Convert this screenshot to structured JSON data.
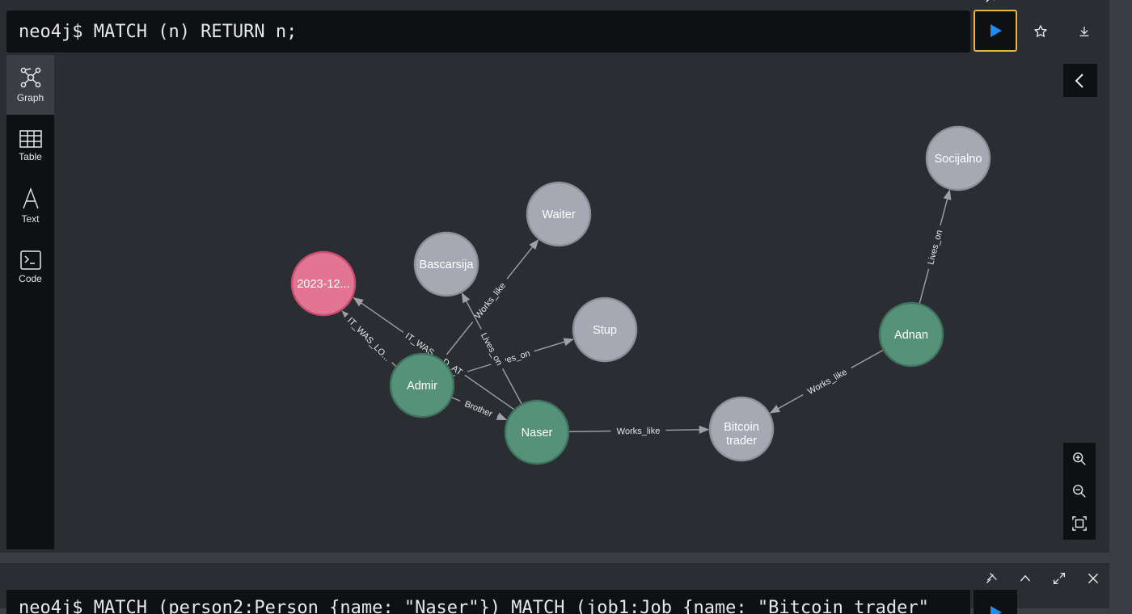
{
  "frame1": {
    "prompt": "neo4j$",
    "query": "MATCH (n) RETURN n;",
    "run_button_color": "#1c8cf0",
    "run_border_color": "#f0b23a"
  },
  "sidebar": {
    "items": [
      {
        "label": "Graph",
        "icon": "graph-icon",
        "active": true
      },
      {
        "label": "Table",
        "icon": "table-icon",
        "active": false
      },
      {
        "label": "Text",
        "icon": "text-icon",
        "active": false
      },
      {
        "label": "Code",
        "icon": "code-icon",
        "active": false
      }
    ]
  },
  "graph": {
    "colors": {
      "person": "#56917a",
      "person_border": "#3f735d",
      "date": "#e27592",
      "date_border": "#c94d70",
      "other": "#a6a9b3",
      "other_border": "#8c8f98",
      "edge": "#9ea1a8"
    },
    "nodes": [
      {
        "id": "date",
        "label": "2023-12...",
        "kind": "date"
      },
      {
        "id": "bascarsija",
        "label": "Bascarsija",
        "kind": "other"
      },
      {
        "id": "waiter",
        "label": "Waiter",
        "kind": "other"
      },
      {
        "id": "stup",
        "label": "Stup",
        "kind": "other"
      },
      {
        "id": "admir",
        "label": "Admir",
        "kind": "person"
      },
      {
        "id": "naser",
        "label": "Naser",
        "kind": "person"
      },
      {
        "id": "bitcoin",
        "label": "Bitcoin trader",
        "label_lines": [
          "Bitcoin",
          "trader"
        ],
        "kind": "other"
      },
      {
        "id": "adnan",
        "label": "Adnan",
        "kind": "person"
      },
      {
        "id": "socijalno",
        "label": "Socijalno",
        "kind": "other"
      }
    ],
    "relationships": [
      {
        "from": "admir",
        "to": "waiter",
        "label": "Works_like"
      },
      {
        "from": "admir",
        "to": "stup",
        "label": "Lives_on"
      },
      {
        "from": "naser",
        "to": "bascarsija",
        "label": "Lives_on"
      },
      {
        "from": "admir",
        "to": "naser",
        "label": "Brother"
      },
      {
        "from": "naser",
        "to": "bitcoin",
        "label": "Works_like"
      },
      {
        "from": "adnan",
        "to": "bitcoin",
        "label": "Works_like"
      },
      {
        "from": "adnan",
        "to": "socijalno",
        "label": "Lives_on"
      },
      {
        "from": "admir",
        "to": "date",
        "label": "IT_WAS_LO..."
      },
      {
        "from": "naser",
        "to": "date",
        "label": "IT_WAS_...D_AT"
      }
    ]
  },
  "frame2": {
    "query": "neo4j$ MATCH (person2:Person {name: \"Naser\"}) MATCH (job1:Job {name: \"Bitcoin trader\""
  }
}
